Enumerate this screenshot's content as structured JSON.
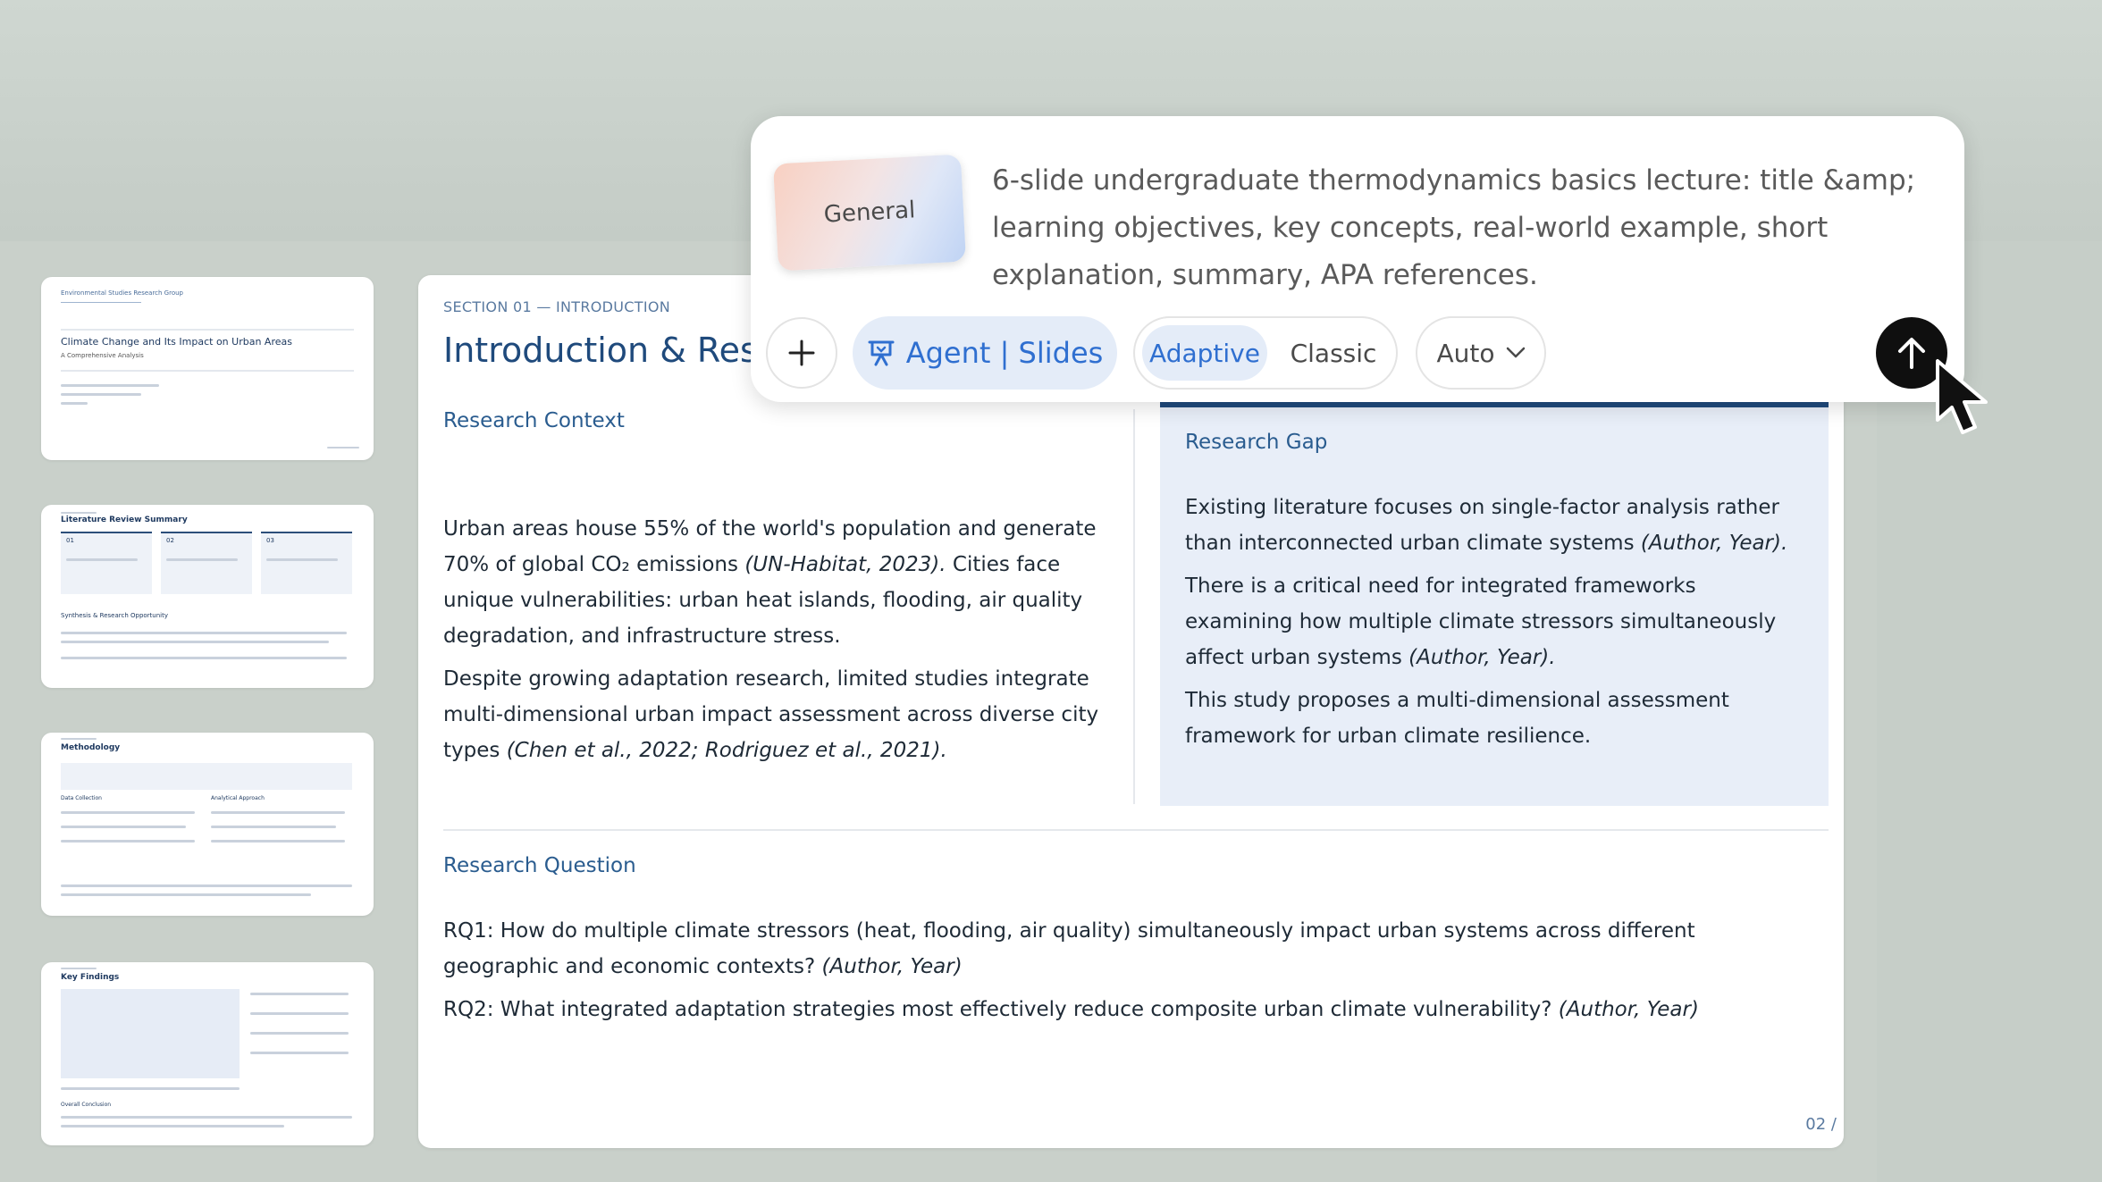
{
  "thumbnails": [
    {
      "org": "Environmental Studies Research Group",
      "title": "Climate Change and Its Impact on Urban Areas",
      "subtitle": "A Comprehensive Analysis"
    },
    {
      "title": "Literature Review Summary",
      "cols": [
        "01",
        "02",
        "03"
      ],
      "footer_heading": "Synthesis & Research Opportunity"
    },
    {
      "title": "Methodology",
      "left_heading": "Data Collection",
      "right_heading": "Analytical Approach"
    },
    {
      "title": "Key Findings",
      "footer_heading": "Overall Conclusion"
    }
  ],
  "slide": {
    "section": "SECTION 01 — INTRODUCTION",
    "title": "Introduction & Resea",
    "context": {
      "heading": "Research Context",
      "p1_a": "Urban areas house 55% of the world's population and generate 70% of global CO₂ emissions ",
      "p1_cite": "(UN-Habitat, 2023).",
      "p1_b": " Cities face unique vulnerabilities: urban heat islands, flooding, air quality degradation, and infrastructure stress.",
      "p2_a": "Despite growing adaptation research, limited studies integrate multi-dimensional urban impact assessment across diverse city types ",
      "p2_cite": "(Chen et al., 2022; Rodriguez et al., 2021)."
    },
    "gap": {
      "heading": "Research Gap",
      "p1_a": "Existing literature focuses on single-factor analysis rather than interconnected urban climate systems ",
      "p1_cite": "(Author, Year).",
      "p2_a": "There is a critical need for integrated frameworks examining how multiple climate stressors simultaneously affect urban systems ",
      "p2_cite": "(Author, Year).",
      "p3": "This study proposes a multi-dimensional assessment framework for urban climate resilience."
    },
    "question": {
      "heading": "Research Question",
      "rq1_a": "RQ1: How do multiple climate stressors (heat, flooding, air quality) simultaneously impact urban systems across different geographic and economic contexts? ",
      "rq1_cite": "(Author, Year)",
      "rq2_a": "RQ2: What integrated adaptation strategies most effectively reduce composite urban climate vulnerability? ",
      "rq2_cite": "(Author, Year)"
    },
    "page": "02 /"
  },
  "prompt": {
    "chip": "General",
    "text": "6-slide undergraduate thermodynamics basics lecture: title &amp; learning objectives, key concepts, real-world example, short explanation, summary, APA references.",
    "agent_label": "Agent | Slides",
    "mode_active": "Adaptive",
    "mode_other": "Classic",
    "auto_label": "Auto"
  },
  "icons": {
    "plus": "plus-icon",
    "agent": "presentation-icon",
    "chevron": "chevron-down-icon",
    "send": "arrow-up-icon",
    "cursor": "mouse-pointer-icon"
  },
  "colors": {
    "accent": "#2f6fd0",
    "slide_title": "#1f4a7c",
    "gap_bg": "#e8eef8"
  }
}
